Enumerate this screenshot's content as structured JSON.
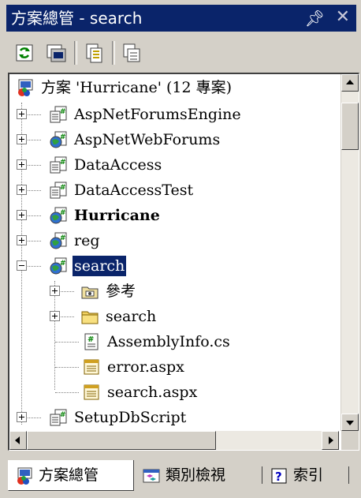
{
  "titlebar": {
    "title": "方案總管 - search",
    "pin_icon": "pushpin-icon",
    "close_icon": "close-icon"
  },
  "toolbar": {
    "buttons": [
      "refresh-icon",
      "show-all-files-icon",
      "properties-icon",
      "copy-project-icon"
    ]
  },
  "tree": {
    "items": [
      {
        "label": "方案 'Hurricane' (12 專案)",
        "icon": "solution-icon",
        "level": 0
      },
      {
        "label": "AspNetForumsEngine",
        "icon": "csharp-project-icon",
        "expander": "plus",
        "level": 1
      },
      {
        "label": "AspNetWebForums",
        "icon": "web-project-icon",
        "expander": "plus",
        "level": 1
      },
      {
        "label": "DataAccess",
        "icon": "csharp-project-icon",
        "expander": "plus",
        "level": 1
      },
      {
        "label": "DataAccessTest",
        "icon": "csharp-project-icon",
        "expander": "plus",
        "level": 1
      },
      {
        "label": "Hurricane",
        "icon": "web-project-icon",
        "expander": "plus",
        "level": 1,
        "bold": true
      },
      {
        "label": "reg",
        "icon": "web-project-icon",
        "expander": "plus",
        "level": 1
      },
      {
        "label": "search",
        "icon": "web-project-icon",
        "expander": "minus",
        "level": 1,
        "selected": true
      },
      {
        "label": "參考",
        "icon": "references-icon",
        "expander": "plus",
        "level": 2
      },
      {
        "label": "search",
        "icon": "folder-icon",
        "expander": "plus",
        "level": 2
      },
      {
        "label": "AssemblyInfo.cs",
        "icon": "csharp-file-icon",
        "level": 2
      },
      {
        "label": "error.aspx",
        "icon": "aspx-file-icon",
        "level": 2
      },
      {
        "label": "search.aspx",
        "icon": "aspx-file-icon",
        "level": 2
      },
      {
        "label": "SetupDbScript",
        "icon": "csharp-project-icon",
        "expander": "plus",
        "level": 1
      }
    ]
  },
  "tabs": [
    {
      "label": "方案總管",
      "icon": "solution-explorer-icon",
      "active": true
    },
    {
      "label": "類別檢視",
      "icon": "class-view-icon",
      "active": false
    },
    {
      "label": "索引",
      "icon": "help-index-icon",
      "active": false
    }
  ],
  "colors": {
    "title_bg": "#0a246a",
    "selection_bg": "#0a246a",
    "chrome": "#d4d0c8"
  }
}
